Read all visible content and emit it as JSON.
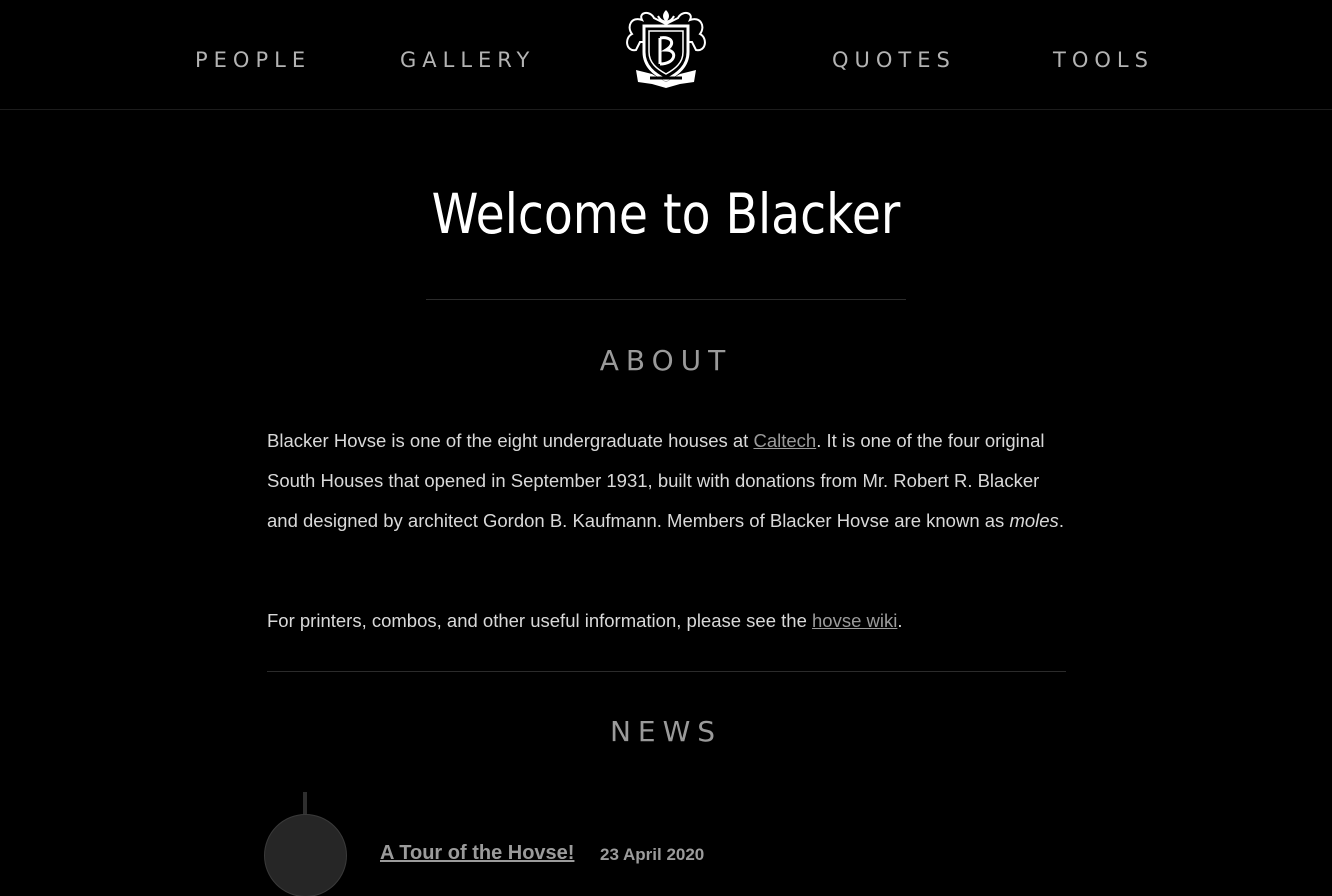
{
  "nav": {
    "people": "PEOPLE",
    "gallery": "GALLERY",
    "quotes": "QUOTES",
    "tools": "TOOLS",
    "logo_text": "BLACKER"
  },
  "page_title": "Welcome to Blacker",
  "about": {
    "heading": "ABOUT",
    "p1_before_link": "Blacker Hovse is one of the eight undergraduate houses at ",
    "p1_link": "Caltech",
    "p1_after_link": ". It is one of the four original South Houses that opened in September 1931, built with donations from Mr. Robert R. Blacker and designed by architect Gordon B. Kaufmann. Members of Blacker Hovse are known as ",
    "p1_em": "moles",
    "p1_end": ".",
    "p2_before_link": "For printers, combos, and other useful information, please see the ",
    "p2_link": "hovse wiki",
    "p2_end": "."
  },
  "news": {
    "heading": "NEWS",
    "items": [
      {
        "title": "A Tour of the Hovse!",
        "date": "23 April 2020"
      }
    ]
  },
  "colors": {
    "background": "#000000",
    "nav_text": "#b3b3b3",
    "title": "#ffffff",
    "heading": "#9a9a9a",
    "body_text": "#d9d9d9",
    "link": "#9b9b9b"
  }
}
